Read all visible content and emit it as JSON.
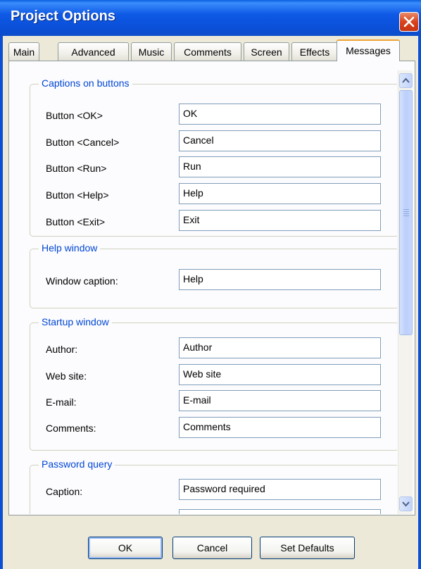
{
  "window": {
    "title": "Project Options"
  },
  "tabs": [
    {
      "label": "Main"
    },
    {
      "label": "Advanced"
    },
    {
      "label": "Music"
    },
    {
      "label": "Comments"
    },
    {
      "label": "Screen"
    },
    {
      "label": "Effects"
    },
    {
      "label": "Messages",
      "active": true
    }
  ],
  "groups": {
    "captions": {
      "title": "Captions on buttons",
      "rows": [
        {
          "label": "Button <OK>",
          "value": "OK"
        },
        {
          "label": "Button <Cancel>",
          "value": "Cancel"
        },
        {
          "label": "Button <Run>",
          "value": "Run"
        },
        {
          "label": "Button <Help>",
          "value": "Help"
        },
        {
          "label": "Button <Exit>",
          "value": "Exit"
        }
      ]
    },
    "help": {
      "title": "Help window",
      "rows": [
        {
          "label": "Window caption:",
          "value": "Help"
        }
      ]
    },
    "startup": {
      "title": "Startup window",
      "rows": [
        {
          "label": "Author:",
          "value": "Author"
        },
        {
          "label": "Web site:",
          "value": "Web site"
        },
        {
          "label": "E-mail:",
          "value": "E-mail"
        },
        {
          "label": "Comments:",
          "value": "Comments"
        }
      ]
    },
    "password": {
      "title": "Password query",
      "rows": [
        {
          "label": "Caption:",
          "value": "Password required"
        }
      ]
    }
  },
  "buttons": {
    "ok": "OK",
    "cancel": "Cancel",
    "set_defaults": "Set Defaults"
  },
  "colors": {
    "accent": "#0046d5",
    "titlebar": "#0a4fd6",
    "close": "#d9431c",
    "active_tab_highlight": "#f0a331"
  },
  "icons": {
    "close": "close-icon",
    "scroll_up": "chevron-up-icon",
    "scroll_down": "chevron-down-icon"
  }
}
